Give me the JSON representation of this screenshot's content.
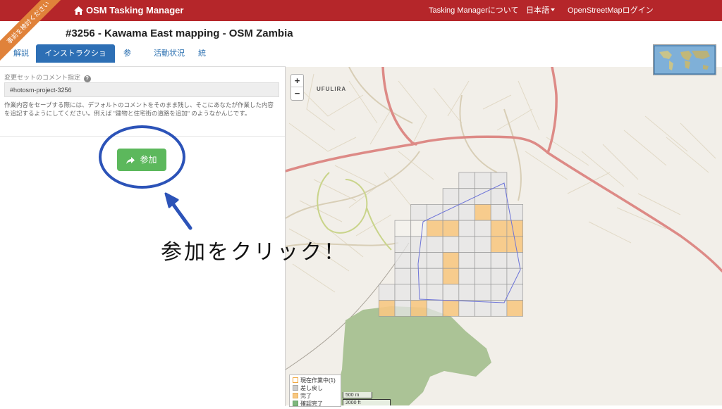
{
  "header": {
    "brand": "OSM Tasking Manager",
    "nav": {
      "about": "Tasking Managerについて",
      "language": "日本語",
      "login": "OpenStreetMapログイン"
    }
  },
  "ribbon": {
    "text": "事前を検討ください"
  },
  "project": {
    "title": "#3256 - Kawama East mapping - OSM Zambia"
  },
  "tabs": [
    {
      "label": "解説",
      "active": false
    },
    {
      "label": "インストラクション",
      "active": true
    },
    {
      "label": "参加",
      "active": false
    },
    {
      "label": "活動状況",
      "active": false
    },
    {
      "label": "統計",
      "active": false
    }
  ],
  "panel": {
    "comment_label": "変更セットのコメント指定",
    "comment_value": "#hotosm-project-3256",
    "help_text": "作業内容をセーブする際には、デフォルトのコメントをそのまま残し、そこにあなたが作業した内容を追記するようにしてください。例えば \"建物と住宅街の道路を追加\" のようなかんじです。",
    "join_button": "参加"
  },
  "annotation": {
    "text": "参加をクリック！"
  },
  "map": {
    "zoom_in": "+",
    "zoom_out": "−",
    "place_label": "UFULIRA",
    "legend": [
      {
        "label": "現在作業中(1)",
        "color": "#ffffff",
        "border": "#f0a53a"
      },
      {
        "label": "差し戻し",
        "color": "#cccccc",
        "border": "#aaaaaa"
      },
      {
        "label": "完了",
        "color": "#f7c883",
        "border": "#e8b060"
      },
      {
        "label": "確認完了",
        "color": "#7fb77e",
        "border": "#6aa36a"
      }
    ],
    "scale_metric": "500 m",
    "scale_imperial": "2000 ft"
  },
  "colors": {
    "header_bg": "#b5262a",
    "tab_active": "#2d6fb5",
    "join_button": "#5cb85c",
    "annotation": "#2c53b8",
    "task_done": "#f7c883",
    "task_grey": "#e5e5e5"
  }
}
